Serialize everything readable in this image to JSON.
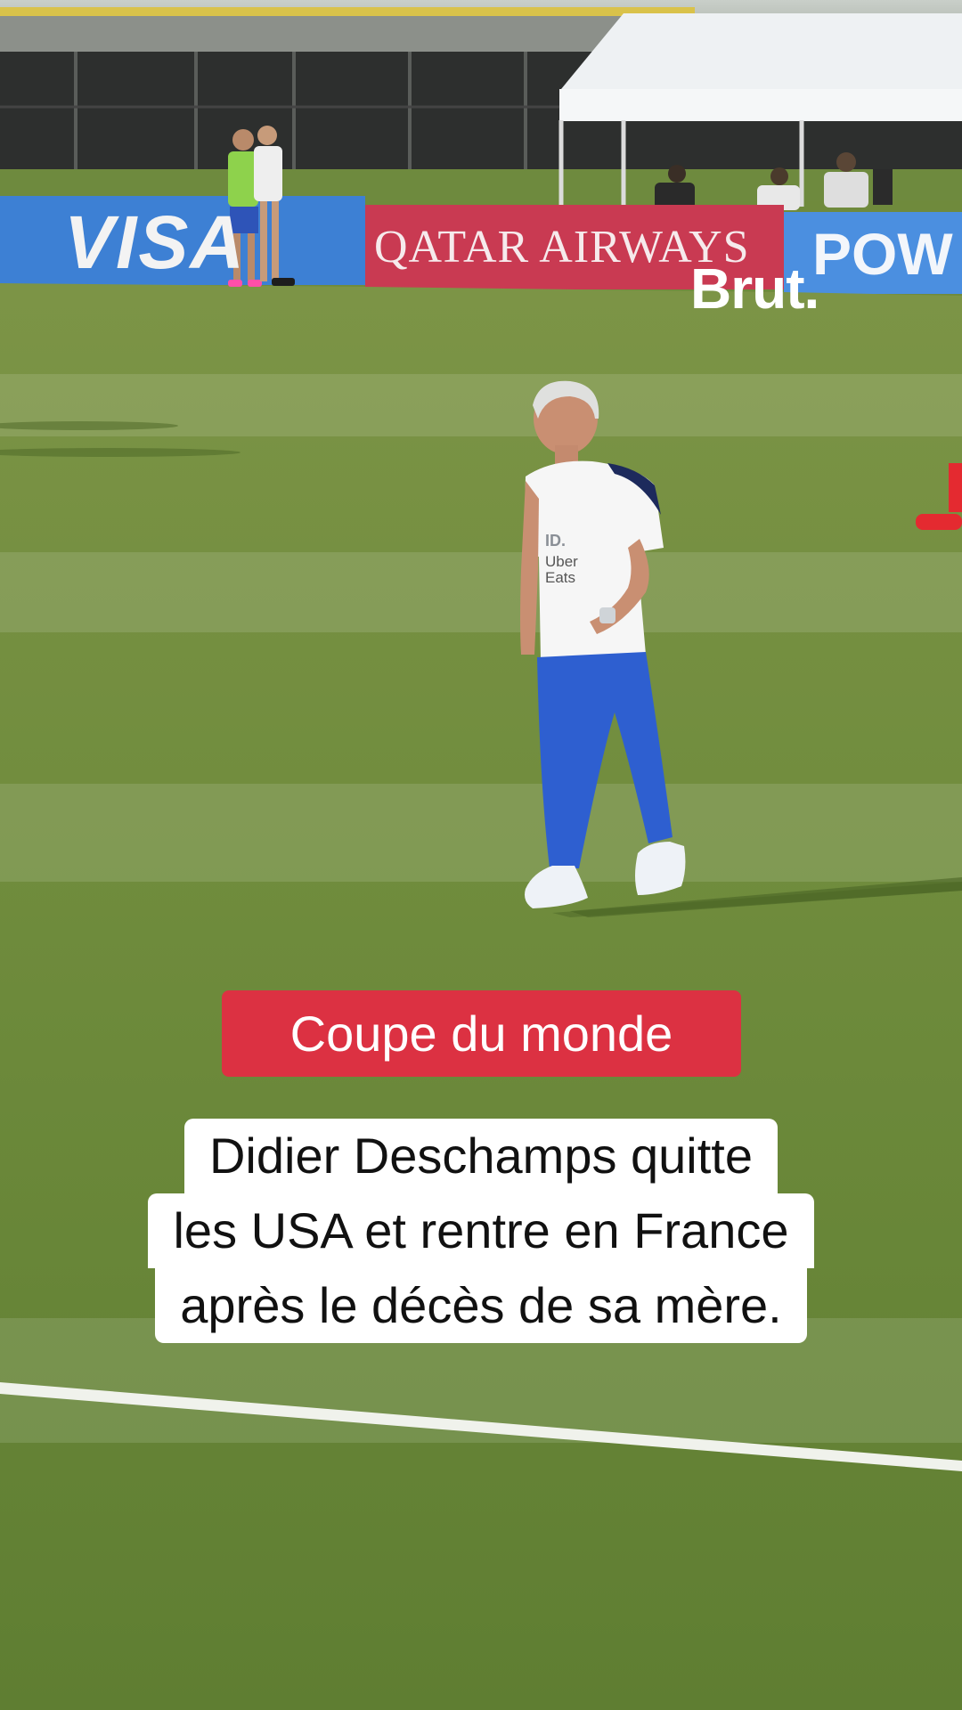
{
  "overlay": {
    "logo": "Brut.",
    "tag": {
      "label": "Coupe du monde",
      "color": "#dc3142"
    },
    "caption": {
      "lines": [
        "Didier Deschamps quitte",
        "les USA et rentre en France",
        "après le décès de sa mère."
      ]
    }
  },
  "scene": {
    "ad_boards": {
      "board_1": "VISA",
      "board_2": "QATAR AIRWAYS",
      "board_3": "POW"
    },
    "shirt_sponsor": {
      "line_1": "ID.",
      "line_2": "Uber",
      "line_3": "Eats"
    },
    "colors": {
      "grass": "#6f8a3c",
      "board_blue": "#3a7bd5",
      "board_red": "#c8344a",
      "tent": "#f2f4f6"
    }
  }
}
